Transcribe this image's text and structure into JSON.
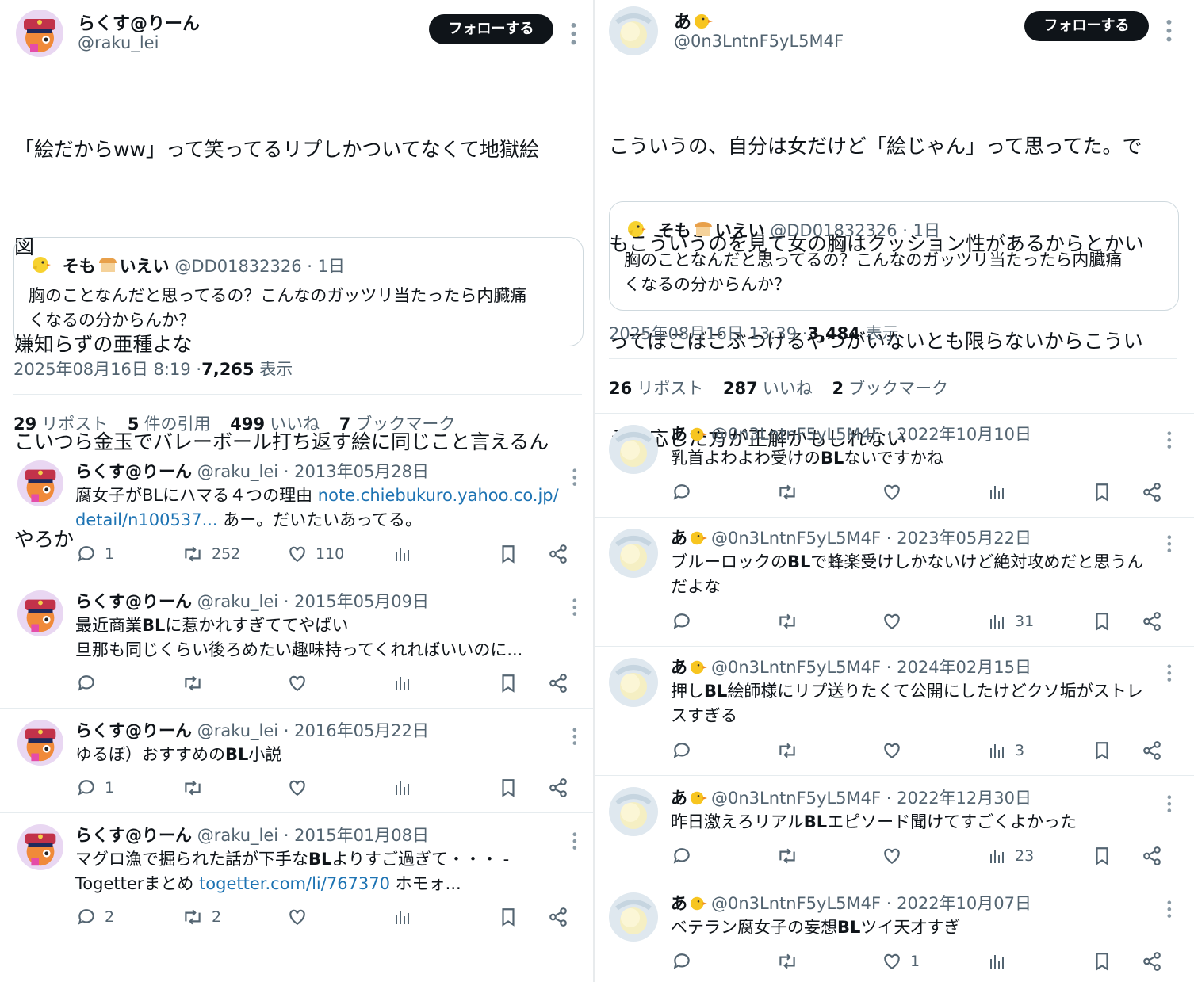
{
  "left": {
    "author": {
      "name": "らくす@りーん",
      "handle": "@raku_lei"
    },
    "follow_label": "フォローする",
    "tweet_lines": [
      "「絵だからww」って笑ってるリプしかついてなくて地獄絵",
      "図",
      "嫌知らずの亜種よな",
      "こいつら金玉でバレーボール打ち返す絵に同じこと言えるん",
      "やろか"
    ],
    "quote": {
      "name_a": "そも",
      "name_b": "いえい",
      "handle": "@DD01832326",
      "sep": "·",
      "time": "1日",
      "lines": [
        "胸のことなんだと思ってるの？こんなのガッツリ当たったら内臓痛",
        "くなるの分からんか？"
      ]
    },
    "timestamp": "2025年08月16日 8:19",
    "dot": "·",
    "views": "7,265",
    "views_label": "表示",
    "stats": [
      {
        "n": "29",
        "label": "リポスト"
      },
      {
        "n": "5",
        "label": "件の引用"
      },
      {
        "n": "499",
        "label": "いいね"
      },
      {
        "n": "7",
        "label": "ブックマーク"
      }
    ],
    "replies": [
      {
        "name": "らくす@りーん",
        "handle": "@raku_lei",
        "date": "· 2013年05月28日",
        "l1a": "腐女子がBLにハマる４つの理由 ",
        "l1link": "note.chiebukuro.yahoo.co.jp/",
        "l2link": "detail/n100537...",
        "l2b": " あー。だいたいあってる。",
        "reply": "1",
        "repost": "252",
        "like": "110",
        "views": ""
      },
      {
        "name": "らくす@りーん",
        "handle": "@raku_lei",
        "date": "· 2015年05月09日",
        "l1a": "最近商業",
        "l1bold": "BL",
        "l1c": "に惹かれすぎててやばい",
        "l2": "旦那も同じくらい後ろめたい趣味持ってくれればいいのに...",
        "reply": "",
        "repost": "",
        "like": "",
        "views": ""
      },
      {
        "name": "らくす@りーん",
        "handle": "@raku_lei",
        "date": "· 2016年05月22日",
        "l1a": "ゆるぼ）おすすめの",
        "l1bold": "BL",
        "l1c": "小説",
        "reply": "1",
        "repost": "",
        "like": "",
        "views": ""
      },
      {
        "name": "らくす@りーん",
        "handle": "@raku_lei",
        "date": "· 2015年01月08日",
        "l1a": "マグロ漁で掘られた話が下手な",
        "l1bold": "BL",
        "l1c": "よりすご過ぎて・・・ -",
        "l2a": "Togetterまとめ ",
        "l2link": "togetter.com/li/767370",
        "l2b": " ホモォ...",
        "reply": "2",
        "repost": "2",
        "like": "",
        "views": ""
      }
    ]
  },
  "right": {
    "author": {
      "name": "あ",
      "handle": "@0n3LntnF5yL5M4F"
    },
    "follow_label": "フォローする",
    "tweet_lines": [
      "こういうの、自分は女だけど「絵じゃん」って思ってた。で",
      "もこういうのを見て女の胸はクッション性があるからとかい",
      "ってぼこぼこぶつけるやつがいないとも限らないからこうい",
      "う反応した方が正解かもしれない"
    ],
    "quote": {
      "name_a": "そも",
      "name_b": "いえい",
      "handle": "@DD01832326",
      "sep": "·",
      "time": "1日",
      "lines": [
        "胸のことなんだと思ってるの？こんなのガッツリ当たったら内臓痛",
        "くなるの分からんか？"
      ]
    },
    "timestamp": "2025年08月16日 13:39",
    "dot": "·",
    "views": "3,484",
    "views_label": "表示",
    "stats": [
      {
        "n": "26",
        "label": "リポスト"
      },
      {
        "n": "287",
        "label": "いいね"
      },
      {
        "n": "2",
        "label": "ブックマーク"
      }
    ],
    "replies": [
      {
        "name": "あ",
        "handle": "@0n3LntnF5yL5M4F",
        "date": "· 2022年10月10日",
        "l1a": "乳首よわよわ受けの",
        "l1bold": "BL",
        "l1c": "ないですかね",
        "like": "",
        "views": ""
      },
      {
        "name": "あ",
        "handle": "@0n3LntnF5yL5M4F",
        "date": "· 2023年05月22日",
        "l1a": "ブルーロックの",
        "l1bold": "BL",
        "l1c": "で蜂楽受けしかないけど絶対攻めだと思うん",
        "l2": "だよな",
        "like": "",
        "views": "31"
      },
      {
        "name": "あ",
        "handle": "@0n3LntnF5yL5M4F",
        "date": "· 2024年02月15日",
        "l1a": "押し",
        "l1bold": "BL",
        "l1c": "絵師様にリプ送りたくて公開にしたけどクソ垢がストレ",
        "l2": "スすぎる",
        "like": "",
        "views": "3"
      },
      {
        "name": "あ",
        "handle": "@0n3LntnF5yL5M4F",
        "date": "· 2022年12月30日",
        "l1a": "昨日激えろリアル",
        "l1bold": "BL",
        "l1c": "エピソード聞けてすごくよかった",
        "like": "",
        "views": "23"
      },
      {
        "name": "あ",
        "handle": "@0n3LntnF5yL5M4F",
        "date": "· 2022年10月07日",
        "l1a": "ベテラン腐女子の妄想",
        "l1bold": "BL",
        "l1c": "ツイ天才すぎ",
        "like": "1",
        "views": ""
      }
    ]
  },
  "icons": [
    "more-icon",
    "reply-icon",
    "repost-icon",
    "like-icon",
    "views-icon",
    "bookmark-icon",
    "share-icon",
    "chick-icon",
    "bread-icon"
  ],
  "colors": {
    "text": "#0f1419",
    "muted": "#536471",
    "link": "#1d73b3",
    "follow_bg": "#0f1419",
    "border": "#cfd9de"
  }
}
